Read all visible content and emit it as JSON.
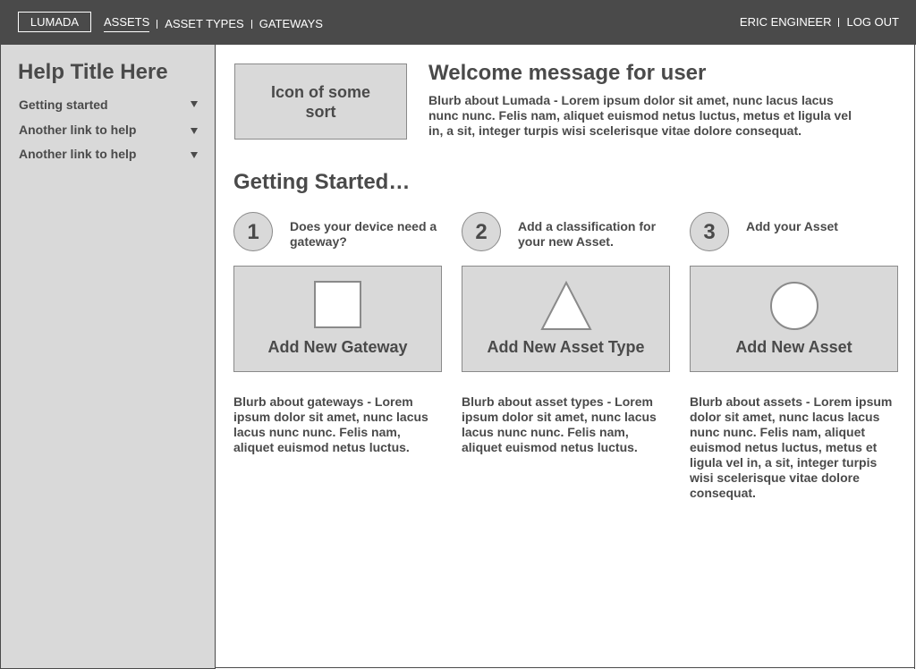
{
  "header": {
    "logo": "LUMADA",
    "nav": [
      "ASSETS",
      "ASSET TYPES",
      "GATEWAYS"
    ],
    "user": "ERIC ENGINEER",
    "logout": "LOG OUT"
  },
  "sidebar": {
    "title": "Help Title Here",
    "links": [
      "Getting started",
      "Another link to help",
      "Another link to help"
    ]
  },
  "welcome": {
    "icon_placeholder": "Icon of some sort",
    "title": "Welcome message for user",
    "blurb": "Blurb about Lumada - Lorem ipsum dolor sit amet, nunc lacus lacus nunc nunc. Felis nam, aliquet euismod netus luctus, metus et ligula vel in, a sit, integer turpis wisi scelerisque vitae dolore consequat."
  },
  "getting_started": {
    "title": "Getting Started…",
    "steps": [
      {
        "number": "1",
        "question": "Does your device need a gateway?",
        "button": "Add New Gateway",
        "shape": "square-icon",
        "blurb": "Blurb about gateways  - Lorem ipsum dolor sit amet, nunc lacus lacus nunc nunc. Felis nam, aliquet euismod netus luctus."
      },
      {
        "number": "2",
        "question": "Add a classification for your new Asset.",
        "button": "Add New Asset Type",
        "shape": "triangle-icon",
        "blurb": "Blurb about asset types  - Lorem ipsum dolor sit amet, nunc lacus lacus nunc nunc. Felis nam, aliquet euismod netus luctus."
      },
      {
        "number": "3",
        "question": "Add your Asset",
        "button": "Add New Asset",
        "shape": "circle-icon",
        "blurb": "Blurb about assets  - Lorem ipsum dolor sit amet, nunc lacus lacus nunc nunc. Felis nam, aliquet euismod netus luctus, metus et ligula vel in, a sit, integer turpis wisi scelerisque vitae dolore consequat."
      }
    ]
  },
  "colors": {
    "topbar": "#4a4a4a",
    "panel": "#d9d9d9",
    "text": "#4a4a4a",
    "border": "#8a8a8a"
  }
}
